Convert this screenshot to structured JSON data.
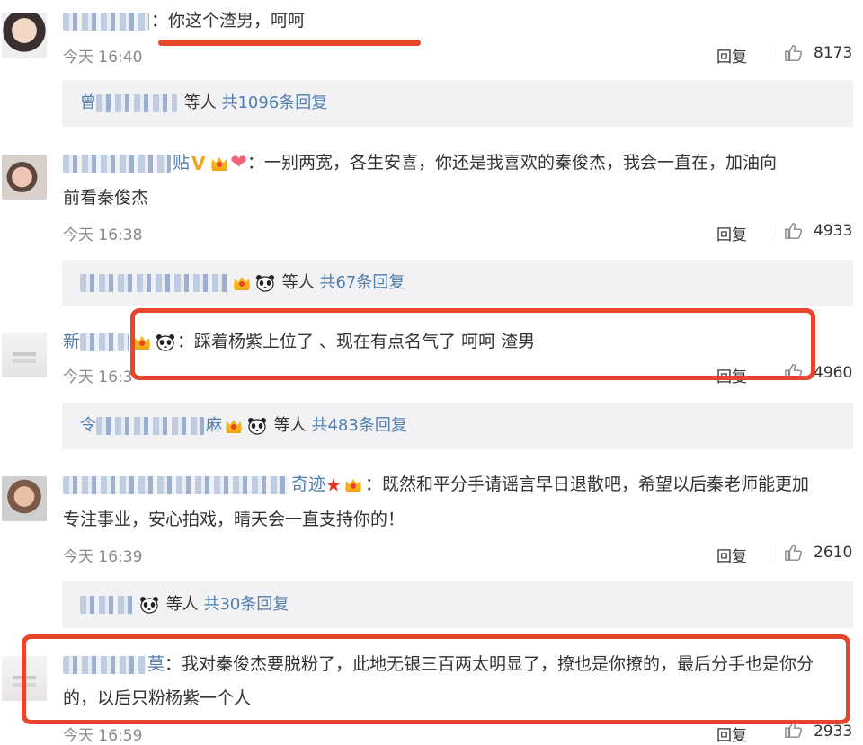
{
  "comments": [
    {
      "name_visible": "",
      "text": "：你这个渣男，呵呵",
      "time": "今天 16:40",
      "reply_label": "回复",
      "likes": "8173",
      "thread": {
        "name_visible": "曾",
        "suffix": "等人",
        "total": "共1096条回复"
      }
    },
    {
      "name_visible": "贴",
      "text_line1": "：一别两宽，各生安喜，你还是我喜欢的秦俊杰，我会一直在，加油向",
      "text_line2": "前看秦俊杰",
      "time": "今天 16:38",
      "reply_label": "回复",
      "likes": "4933",
      "thread": {
        "name_visible": "",
        "suffix": "等人",
        "total": "共67条回复"
      }
    },
    {
      "name_visible": "新",
      "text": "：踩着杨紫上位了 、现在有点名气了 呵呵 渣男",
      "time": "今天 16:3",
      "reply_label": "回复",
      "likes": "4960",
      "thread": {
        "name_visible": "令",
        "suffix_name": "麻",
        "suffix": "等人",
        "total": "共483条回复"
      }
    },
    {
      "name_visible": "奇迹",
      "text_line1": "：既然和平分手请谣言早日退散吧，希望以后秦老师能更加",
      "text_line2": "专注事业，安心拍戏，晴天会一直支持你的！",
      "time": "今天 16:39",
      "reply_label": "回复",
      "likes": "2610",
      "thread": {
        "name_visible": "",
        "suffix": "等人",
        "total": "共30条回复"
      }
    },
    {
      "name_visible": "莫",
      "text_line1": "：我对秦俊杰要脱粉了，此地无银三百两太明显了，撩也是你撩的，最后分手也是你分",
      "text_line2": "的，以后只粉杨紫一个人",
      "time": "今天 16:59",
      "reply_label": "回复",
      "likes": "2933"
    }
  ],
  "colors": {
    "link": "#507daf",
    "highlight": "#e8462a",
    "reply_bg": "#f2f2f5"
  },
  "icons": [
    "like-icon",
    "crown-icon",
    "panda-icon",
    "heart-icon",
    "star-icon",
    "v-badge-icon"
  ]
}
